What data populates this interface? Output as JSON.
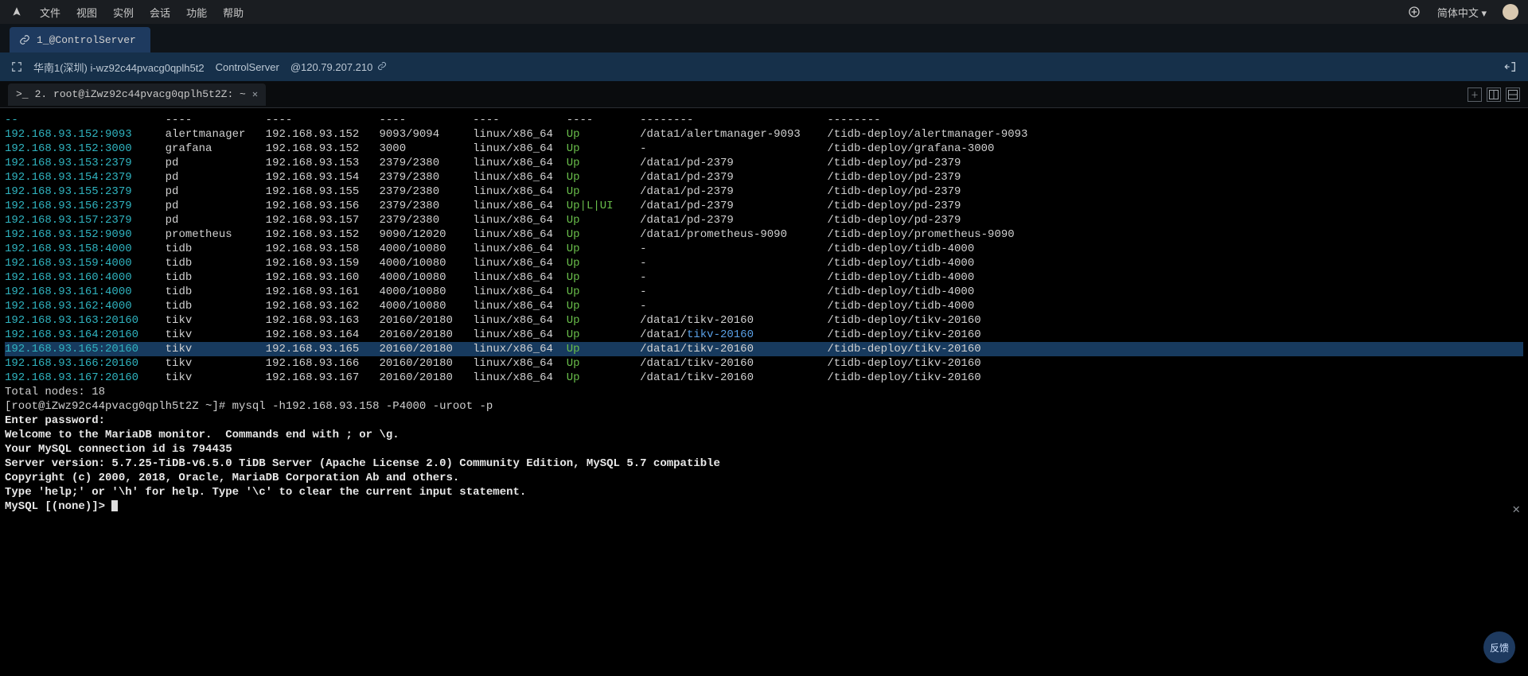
{
  "menu": {
    "items": [
      "文件",
      "视图",
      "实例",
      "会话",
      "功能",
      "帮助"
    ],
    "lang": "简体中文"
  },
  "main_tab": {
    "label": "1_@ControlServer"
  },
  "connection": {
    "region_host": "华南1(深圳) i-wz92c44pvacg0qplh5t2",
    "server": "ControlServer",
    "ip": "@120.79.207.210"
  },
  "term_tab": {
    "label": "2. root@iZwz92c44pvacg0qplh5t2Z: ~"
  },
  "header_dashes": {
    "id": "--",
    "role": "----",
    "host": "----",
    "ports": "----",
    "os": "----",
    "status": "----",
    "dir": "--------",
    "deploy": "--------"
  },
  "nodes": [
    {
      "id": "192.168.93.152:9093",
      "role": "alertmanager",
      "host": "192.168.93.152",
      "ports": "9093/9094",
      "os": "linux/x86_64",
      "status": "Up",
      "dir": "/data1/alertmanager-9093",
      "deploy": "/tidb-deploy/alertmanager-9093",
      "hi": false
    },
    {
      "id": "192.168.93.152:3000",
      "role": "grafana",
      "host": "192.168.93.152",
      "ports": "3000",
      "os": "linux/x86_64",
      "status": "Up",
      "dir": "-",
      "deploy": "/tidb-deploy/grafana-3000",
      "hi": false
    },
    {
      "id": "192.168.93.153:2379",
      "role": "pd",
      "host": "192.168.93.153",
      "ports": "2379/2380",
      "os": "linux/x86_64",
      "status": "Up",
      "dir": "/data1/pd-2379",
      "deploy": "/tidb-deploy/pd-2379",
      "hi": false
    },
    {
      "id": "192.168.93.154:2379",
      "role": "pd",
      "host": "192.168.93.154",
      "ports": "2379/2380",
      "os": "linux/x86_64",
      "status": "Up",
      "dir": "/data1/pd-2379",
      "deploy": "/tidb-deploy/pd-2379",
      "hi": false
    },
    {
      "id": "192.168.93.155:2379",
      "role": "pd",
      "host": "192.168.93.155",
      "ports": "2379/2380",
      "os": "linux/x86_64",
      "status": "Up",
      "dir": "/data1/pd-2379",
      "deploy": "/tidb-deploy/pd-2379",
      "hi": false
    },
    {
      "id": "192.168.93.156:2379",
      "role": "pd",
      "host": "192.168.93.156",
      "ports": "2379/2380",
      "os": "linux/x86_64",
      "status": "Up|L|UI",
      "dir": "/data1/pd-2379",
      "deploy": "/tidb-deploy/pd-2379",
      "hi": false
    },
    {
      "id": "192.168.93.157:2379",
      "role": "pd",
      "host": "192.168.93.157",
      "ports": "2379/2380",
      "os": "linux/x86_64",
      "status": "Up",
      "dir": "/data1/pd-2379",
      "deploy": "/tidb-deploy/pd-2379",
      "hi": false
    },
    {
      "id": "192.168.93.152:9090",
      "role": "prometheus",
      "host": "192.168.93.152",
      "ports": "9090/12020",
      "os": "linux/x86_64",
      "status": "Up",
      "dir": "/data1/prometheus-9090",
      "deploy": "/tidb-deploy/prometheus-9090",
      "hi": false
    },
    {
      "id": "192.168.93.158:4000",
      "role": "tidb",
      "host": "192.168.93.158",
      "ports": "4000/10080",
      "os": "linux/x86_64",
      "status": "Up",
      "dir": "-",
      "deploy": "/tidb-deploy/tidb-4000",
      "hi": false
    },
    {
      "id": "192.168.93.159:4000",
      "role": "tidb",
      "host": "192.168.93.159",
      "ports": "4000/10080",
      "os": "linux/x86_64",
      "status": "Up",
      "dir": "-",
      "deploy": "/tidb-deploy/tidb-4000",
      "hi": false
    },
    {
      "id": "192.168.93.160:4000",
      "role": "tidb",
      "host": "192.168.93.160",
      "ports": "4000/10080",
      "os": "linux/x86_64",
      "status": "Up",
      "dir": "-",
      "deploy": "/tidb-deploy/tidb-4000",
      "hi": false
    },
    {
      "id": "192.168.93.161:4000",
      "role": "tidb",
      "host": "192.168.93.161",
      "ports": "4000/10080",
      "os": "linux/x86_64",
      "status": "Up",
      "dir": "-",
      "deploy": "/tidb-deploy/tidb-4000",
      "hi": false
    },
    {
      "id": "192.168.93.162:4000",
      "role": "tidb",
      "host": "192.168.93.162",
      "ports": "4000/10080",
      "os": "linux/x86_64",
      "status": "Up",
      "dir": "-",
      "deploy": "/tidb-deploy/tidb-4000",
      "hi": false
    },
    {
      "id": "192.168.93.163:20160",
      "role": "tikv",
      "host": "192.168.93.163",
      "ports": "20160/20180",
      "os": "linux/x86_64",
      "status": "Up",
      "dir": "/data1/tikv-20160",
      "deploy": "/tidb-deploy/tikv-20160",
      "hi": false
    },
    {
      "id": "192.168.93.164:20160",
      "role": "tikv",
      "host": "192.168.93.164",
      "ports": "20160/20180",
      "os": "linux/x86_64",
      "status": "Up",
      "dir": "/data1/",
      "dir_b": "tikv-20160",
      "deploy": "/tidb-deploy/tikv-20160",
      "hi": false
    },
    {
      "id": "192.168.93.165:20160",
      "role": "tikv",
      "host": "192.168.93.165",
      "ports": "20160/20180",
      "os": "linux/x86_64",
      "status": "Up",
      "dir": "/data1/tikv-20160",
      "deploy": "/tidb-deploy/tikv-20160",
      "hi": true
    },
    {
      "id": "192.168.93.166:20160",
      "role": "tikv",
      "host": "192.168.93.166",
      "ports": "20160/20180",
      "os": "linux/x86_64",
      "status": "Up",
      "dir": "/data1/tikv-20160",
      "deploy": "/tidb-deploy/tikv-20160",
      "hi": false
    },
    {
      "id": "192.168.93.167:20160",
      "role": "tikv",
      "host": "192.168.93.167",
      "ports": "20160/20180",
      "os": "linux/x86_64",
      "status": "Up",
      "dir": "/data1/tikv-20160",
      "deploy": "/tidb-deploy/tikv-20160",
      "hi": false
    }
  ],
  "totals": "Total nodes: 18",
  "prompt_line": {
    "prompt": "[root@iZwz92c44pvacg0qplh5t2Z ~]# ",
    "cmd": "mysql -h192.168.93.158 -P4000 -uroot -p"
  },
  "session_lines": [
    "Enter password:",
    "Welcome to the MariaDB monitor.  Commands end with ; or \\g.",
    "Your MySQL connection id is 794435",
    "Server version: 5.7.25-TiDB-v6.5.0 TiDB Server (Apache License 2.0) Community Edition, MySQL 5.7 compatible",
    "",
    "Copyright (c) 2000, 2018, Oracle, MariaDB Corporation Ab and others.",
    "",
    "Type 'help;' or '\\h' for help. Type '\\c' to clear the current input statement.",
    ""
  ],
  "sql_prompt": "MySQL [(none)]> ",
  "feedback": "反馈",
  "cols": {
    "id": 24,
    "role": 15,
    "host": 17,
    "ports": 14,
    "os": 14,
    "status": 11,
    "dir": 28
  }
}
